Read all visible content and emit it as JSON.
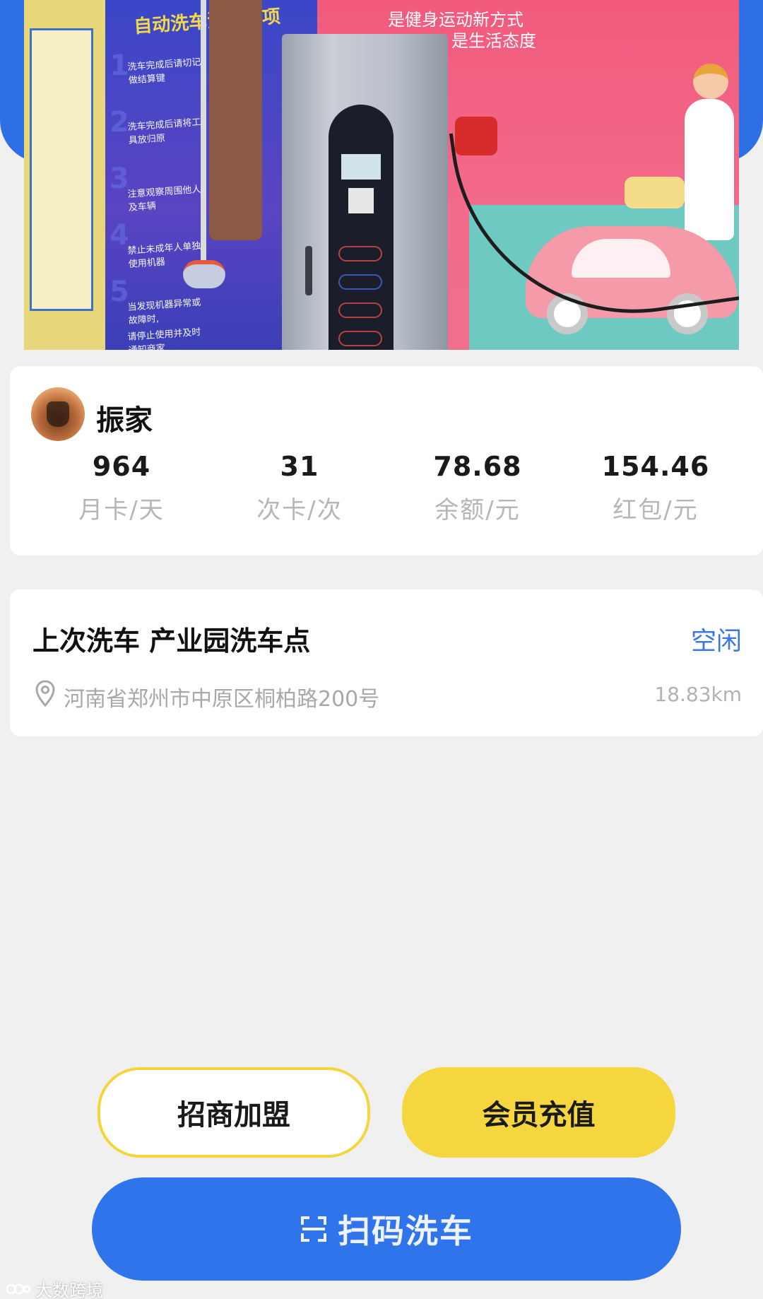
{
  "banner": {
    "sign_title": "自动洗车注意事项",
    "sign_lines": [
      "洗车完成后请切记做结算键",
      "洗车完成后请将工具放归原",
      "注意观察周围他人及车辆",
      "禁止未成年人单独使用机器",
      "当发现机器异常或故障时,",
      "请停止使用并及时通知商家"
    ],
    "sign_numbers": [
      "1",
      "2",
      "3",
      "4",
      "5"
    ],
    "slogan_line1": "是健身运动新方式",
    "slogan_line2": "是生活态度"
  },
  "user": {
    "name": "振家"
  },
  "stats": [
    {
      "value": "964",
      "label": "月卡/天"
    },
    {
      "value": "31",
      "label": "次卡/次"
    },
    {
      "value": "78.68",
      "label": "余额/元"
    },
    {
      "value": "154.46",
      "label": "红包/元"
    }
  ],
  "last_wash": {
    "title": "上次洗车 产业园洗车点",
    "status": "空闲",
    "address": "河南省郑州市中原区桐柏路200号",
    "distance": "18.83km"
  },
  "actions": {
    "franchise_label": "招商加盟",
    "recharge_label": "会员充值",
    "scan_label": "扫码洗车"
  },
  "watermark": "大数跨境",
  "colors": {
    "primary_blue": "#2f74ea",
    "accent_yellow": "#f5d63f",
    "status_blue": "#3b78e6",
    "background": "#f0f0f0"
  }
}
